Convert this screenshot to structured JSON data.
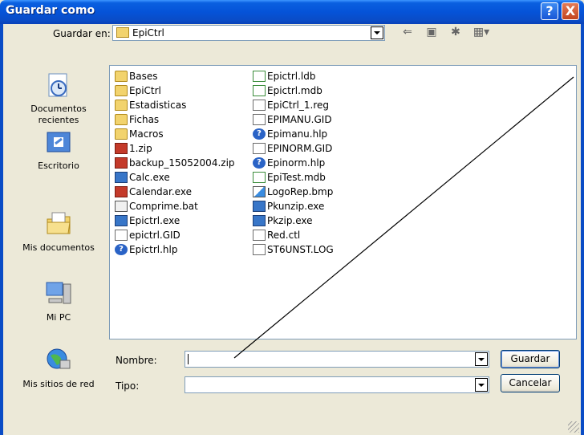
{
  "window": {
    "title": "Guardar como",
    "help_glyph": "?",
    "close_glyph": "X"
  },
  "toolbar": {
    "save_in_label": "Guardar en:",
    "location": "EpiCtrl",
    "icons": [
      "back-icon",
      "up-folder-icon",
      "new-folder-icon",
      "view-menu-icon"
    ]
  },
  "places": [
    {
      "label": "Documentos recientes",
      "icon": "recent-documents-icon"
    },
    {
      "label": "Escritorio",
      "icon": "desktop-icon"
    },
    {
      "label": "Mis documentos",
      "icon": "my-documents-icon"
    },
    {
      "label": "Mi PC",
      "icon": "my-computer-icon"
    },
    {
      "label": "Mis sitios de red",
      "icon": "network-places-icon"
    }
  ],
  "files_col1": [
    {
      "name": "Bases",
      "type": "folder"
    },
    {
      "name": "EpiCtrl",
      "type": "folder"
    },
    {
      "name": "Estadisticas",
      "type": "folder"
    },
    {
      "name": "Fichas",
      "type": "folder"
    },
    {
      "name": "Macros",
      "type": "folder"
    },
    {
      "name": "1.zip",
      "type": "zip"
    },
    {
      "name": "backup_15052004.zip",
      "type": "zip"
    },
    {
      "name": "Calc.exe",
      "type": "exe"
    },
    {
      "name": "Calendar.exe",
      "type": "exe"
    },
    {
      "name": "Comprime.bat",
      "type": "bat"
    },
    {
      "name": "Epictrl.exe",
      "type": "exe"
    },
    {
      "name": "epictrl.GID",
      "type": "doc"
    },
    {
      "name": "Epictrl.hlp",
      "type": "help"
    }
  ],
  "files_col2": [
    {
      "name": "Epictrl.ldb",
      "type": "db"
    },
    {
      "name": "Epictrl.mdb",
      "type": "db"
    },
    {
      "name": "EpiCtrl_1.reg",
      "type": "doc"
    },
    {
      "name": "EPIMANU.GID",
      "type": "doc"
    },
    {
      "name": "Epimanu.hlp",
      "type": "help"
    },
    {
      "name": "EPINORM.GID",
      "type": "doc"
    },
    {
      "name": "Epinorm.hlp",
      "type": "help"
    },
    {
      "name": "EpiTest.mdb",
      "type": "db"
    },
    {
      "name": "LogoRep.bmp",
      "type": "bmp"
    },
    {
      "name": "Pkunzip.exe",
      "type": "exe"
    },
    {
      "name": "Pkzip.exe",
      "type": "exe"
    },
    {
      "name": "Red.ctl",
      "type": "doc"
    },
    {
      "name": "ST6UNST.LOG",
      "type": "doc"
    }
  ],
  "form": {
    "name_label": "Nombre:",
    "name_value": "",
    "type_label": "Tipo:",
    "type_value": ""
  },
  "buttons": {
    "save": "Guardar",
    "cancel": "Cancelar"
  },
  "colors": {
    "title_bar": "#0553d8",
    "dialog_bg": "#ece9d8",
    "border": "#7f9db9"
  }
}
